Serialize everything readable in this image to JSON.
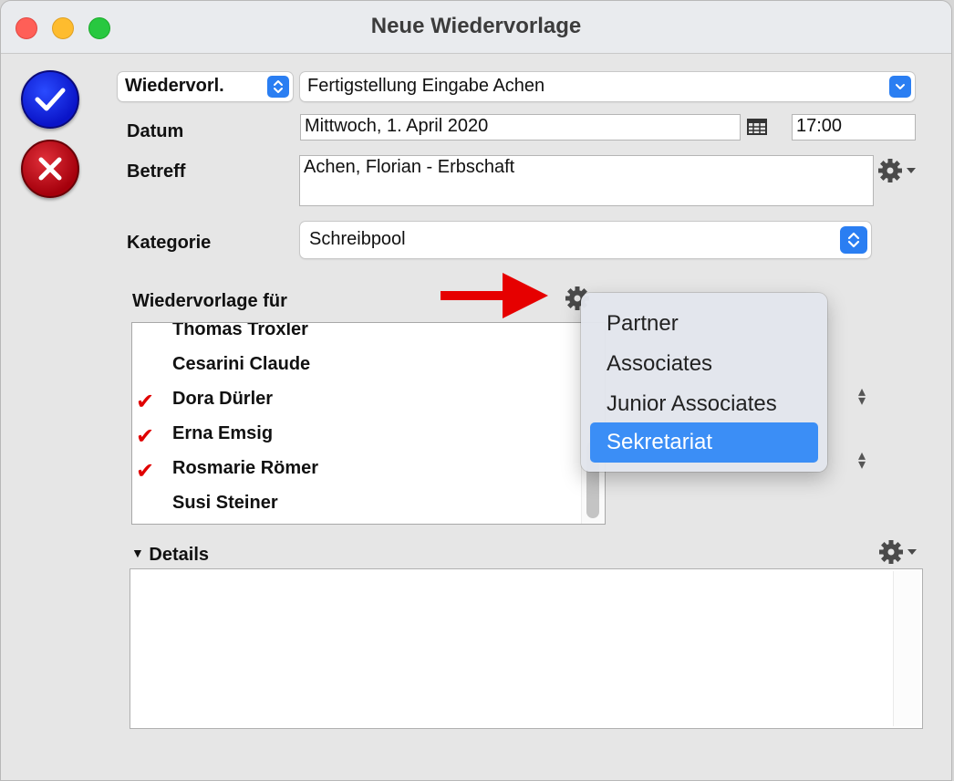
{
  "window": {
    "title": "Neue Wiedervorlage"
  },
  "header": {
    "type_popup": "Wiedervorl.",
    "subject_popup": "Fertigstellung Eingabe Achen"
  },
  "form": {
    "datum_label": "Datum",
    "date_value": "Mittwoch, 1. April 2020",
    "time_value": "17:00",
    "betreff_label": "Betreff",
    "betreff_value": "Achen, Florian - Erbschaft",
    "kategorie_label": "Kategorie",
    "kategorie_value": "Schreibpool"
  },
  "wiedervorlage": {
    "label": "Wiedervorlage für",
    "checkmark": "✔",
    "people": [
      {
        "name": "Thomas Troxler",
        "checked": false
      },
      {
        "name": "Cesarini Claude",
        "checked": false
      },
      {
        "name": "Dora Dürler",
        "checked": true
      },
      {
        "name": "Erna Emsig",
        "checked": true
      },
      {
        "name": "Rosmarie Römer",
        "checked": true
      },
      {
        "name": "Susi Steiner",
        "checked": false
      }
    ]
  },
  "group_menu": {
    "items": [
      "Partner",
      "Associates",
      "Junior Associates",
      "Sekretariat"
    ],
    "selected": "Sekretariat"
  },
  "details": {
    "label": "Details"
  },
  "colors": {
    "accent": "#3b8ef6",
    "ok_button": "#0a14c8",
    "cancel_button": "#a5000c",
    "checkmark": "#e00000",
    "arrow": "#e60000"
  }
}
